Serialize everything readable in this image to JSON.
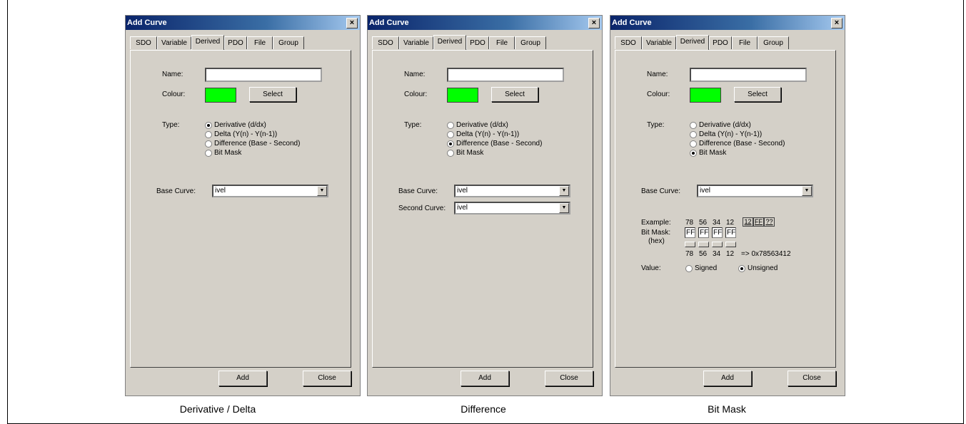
{
  "windows": [
    {
      "title": "Add Curve",
      "tabs": [
        "SDO",
        "Variable",
        "Derived",
        "PDO",
        "File",
        "Group"
      ],
      "name_label": "Name:",
      "colour_label": "Colour:",
      "colour": "#00ff00",
      "select_label": "Select",
      "type_label": "Type:",
      "types": [
        "Derivative  (d/dx)",
        "Delta  (Y(n) - Y(n-1))",
        "Difference  (Base - Second)",
        "Bit Mask"
      ],
      "selected_type": 0,
      "base_curve_label": "Base Curve:",
      "base_curve_value": "ivel",
      "add_label": "Add",
      "close_label": "Close",
      "caption": "Derivative / Delta"
    },
    {
      "title": "Add Curve",
      "tabs": [
        "SDO",
        "Variable",
        "Derived",
        "PDO",
        "File",
        "Group"
      ],
      "name_label": "Name:",
      "colour_label": "Colour:",
      "colour": "#00ff00",
      "select_label": "Select",
      "type_label": "Type:",
      "types": [
        "Derivative  (d/dx)",
        "Delta  (Y(n) - Y(n-1))",
        "Difference  (Base - Second)",
        "Bit Mask"
      ],
      "selected_type": 2,
      "base_curve_label": "Base Curve:",
      "base_curve_value": "ivel",
      "second_curve_label": "Second Curve:",
      "second_curve_value": "ivel",
      "add_label": "Add",
      "close_label": "Close",
      "caption": "Difference"
    },
    {
      "title": "Add Curve",
      "tabs": [
        "SDO",
        "Variable",
        "Derived",
        "PDO",
        "File",
        "Group"
      ],
      "name_label": "Name:",
      "colour_label": "Colour:",
      "colour": "#00ff00",
      "select_label": "Select",
      "type_label": "Type:",
      "types": [
        "Derivative  (d/dx)",
        "Delta  (Y(n) - Y(n-1))",
        "Difference  (Base - Second)",
        "Bit Mask"
      ],
      "selected_type": 3,
      "base_curve_label": "Base Curve:",
      "base_curve_value": "ivel",
      "example_label": "Example:",
      "example_bytes": [
        "78",
        "56",
        "34",
        "12"
      ],
      "hex_buttons": [
        "12",
        "FF",
        "??"
      ],
      "bitmask_label": "Bit Mask:",
      "hex_label": "(hex)",
      "mask_values": [
        "FF",
        "FF",
        "FF",
        "FF"
      ],
      "result_bytes": [
        "78",
        "56",
        "34",
        "12"
      ],
      "result_text": "=> 0x78563412",
      "value_label": "Value:",
      "signed_label": "Signed",
      "unsigned_label": "Unsigned",
      "value_selected": "unsigned",
      "add_label": "Add",
      "close_label": "Close",
      "caption": "Bit Mask"
    }
  ]
}
